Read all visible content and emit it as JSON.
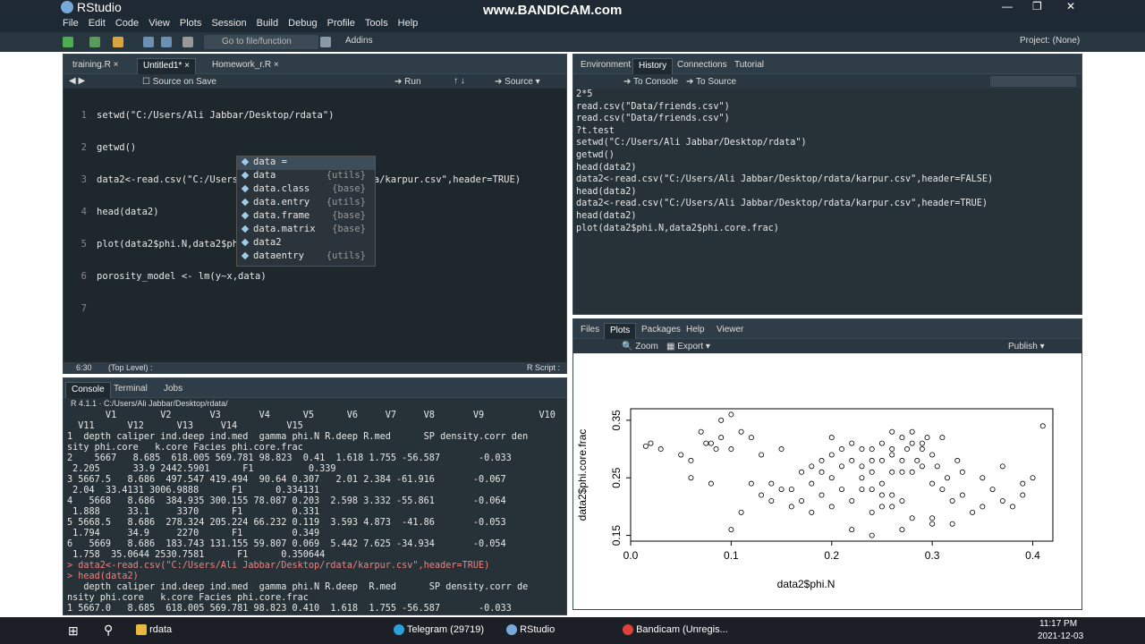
{
  "app": {
    "title": "RStudio",
    "watermark": "www.BANDICAM.com"
  },
  "menu": [
    "File",
    "Edit",
    "Code",
    "View",
    "Plots",
    "Session",
    "Build",
    "Debug",
    "Profile",
    "Tools",
    "Help"
  ],
  "toolbar": {
    "goto": "Go to file/function",
    "addins": "Addins",
    "project": "Project: (None)"
  },
  "editor": {
    "tabs": [
      "training.R",
      "Untitled1*",
      "Homework_r.R"
    ],
    "source_on_save": "Source on Save",
    "run": "Run",
    "source": "Source",
    "line_numbers": [
      "1",
      "2",
      "3",
      "4",
      "5",
      "6",
      "7"
    ],
    "lines": [
      "setwd(\"C:/Users/Ali Jabbar/Desktop/rdata\")",
      "getwd()",
      "data2<-read.csv(\"C:/Users/Ali Jabbar/Desktop/rdata/karpur.csv\",header=TRUE)",
      "head(data2)",
      "plot(data2$phi.N,data2$phi.core.frac)",
      "porosity_model <- lm(y~x,data)",
      ""
    ],
    "status_pos": "6:30",
    "status_scope": "(Top Level) :",
    "status_type": "R Script :"
  },
  "autocomplete": [
    {
      "name": "data =",
      "pkg": ""
    },
    {
      "name": "data",
      "pkg": "{utils}"
    },
    {
      "name": "data.class",
      "pkg": "{base}"
    },
    {
      "name": "data.entry",
      "pkg": "{utils}"
    },
    {
      "name": "data.frame",
      "pkg": "{base}"
    },
    {
      "name": "data.matrix",
      "pkg": "{base}"
    },
    {
      "name": "data2",
      "pkg": ""
    },
    {
      "name": "dataentry",
      "pkg": "{utils}"
    }
  ],
  "console": {
    "tabs": [
      "Console",
      "Terminal",
      "Jobs"
    ],
    "path": "R 4.1.1 · C:/Users/Ali Jabbar/Desktop/rdata/",
    "lines": [
      "       V1        V2       V3       V4      V5      V6     V7     V8       V9          V10",
      "  V11      V12      V13     V14         V15",
      "1  depth caliper ind.deep ind.med  gamma phi.N R.deep R.med      SP density.corr den",
      "sity phi.core   k.core Facies phi.core.frac",
      "2    5667   8.685  618.005 569.781 98.823  0.41  1.618 1.755 -56.587       -0.033",
      " 2.205      33.9 2442.5901      F1          0.339",
      "3 5667.5   8.686  497.547 419.494  90.64 0.307   2.01 2.384 -61.916       -0.067",
      " 2.04  33.4131 3006.9888      F1      0.334131",
      "4   5668   8.686  384.935 300.155 78.087 0.203  2.598 3.332 -55.861       -0.064",
      " 1.888     33.1     3370      F1         0.331",
      "5 5668.5   8.686  278.324 205.224 66.232 0.119  3.593 4.873  -41.86       -0.053",
      " 1.794     34.9     2270      F1         0.349",
      "6   5669   8.686  183.743 131.155 59.807 0.069  5.442 7.625 -34.934       -0.054",
      " 1.758  35.0644 2530.7581      F1      0.350644",
      "> data2<-read.csv(\"C:/Users/Ali Jabbar/Desktop/rdata/karpur.csv\",header=TRUE)",
      "> head(data2)",
      "   depth caliper ind.deep ind.med  gamma phi.N R.deep  R.med      SP density.corr de",
      "nsity phi.core   k.core Facies phi.core.frac",
      "1 5667.0   8.685  618.005 569.781 98.823 0.410  1.618  1.755 -56.587       -0.033"
    ]
  },
  "history": {
    "tabs": [
      "Environment",
      "History",
      "Connections",
      "Tutorial"
    ],
    "to_console": "To Console",
    "to_source": "To Source",
    "lines": [
      "2*5",
      "read.csv(\"Data/friends.csv\")",
      "read.csv(\"Data/friends.csv\")",
      "?t.test",
      "setwd(\"C:/Users/Ali Jabbar/Desktop/rdata\")",
      "getwd()",
      "head(data2)",
      "data2<-read.csv(\"C:/Users/Ali Jabbar/Desktop/rdata/karpur.csv\",header=FALSE)",
      "head(data2)",
      "data2<-read.csv(\"C:/Users/Ali Jabbar/Desktop/rdata/karpur.csv\",header=TRUE)",
      "head(data2)",
      "plot(data2$phi.N,data2$phi.core.frac)"
    ]
  },
  "plots": {
    "tabs": [
      "Files",
      "Plots",
      "Packages",
      "Help",
      "Viewer"
    ],
    "zoom": "Zoom",
    "export": "Export",
    "publish": "Publish"
  },
  "chart_data": {
    "type": "scatter",
    "xlabel": "data2$phi.N",
    "ylabel": "data2$phi.core.frac",
    "xticks": [
      "0.0",
      "0.1",
      "0.2",
      "0.3",
      "0.4"
    ],
    "yticks": [
      "0.15",
      "0.25",
      "0.35"
    ],
    "xlim": [
      0.0,
      0.42
    ],
    "ylim": [
      0.14,
      0.37
    ],
    "points": [
      [
        0.015,
        0.305
      ],
      [
        0.02,
        0.31
      ],
      [
        0.03,
        0.3
      ],
      [
        0.05,
        0.29
      ],
      [
        0.06,
        0.28
      ],
      [
        0.07,
        0.33
      ],
      [
        0.075,
        0.31
      ],
      [
        0.08,
        0.31
      ],
      [
        0.085,
        0.3
      ],
      [
        0.09,
        0.32
      ],
      [
        0.1,
        0.3
      ],
      [
        0.11,
        0.33
      ],
      [
        0.12,
        0.32
      ],
      [
        0.13,
        0.29
      ],
      [
        0.09,
        0.35
      ],
      [
        0.1,
        0.36
      ],
      [
        0.06,
        0.25
      ],
      [
        0.08,
        0.24
      ],
      [
        0.1,
        0.16
      ],
      [
        0.11,
        0.19
      ],
      [
        0.14,
        0.24
      ],
      [
        0.15,
        0.23
      ],
      [
        0.17,
        0.26
      ],
      [
        0.18,
        0.27
      ],
      [
        0.19,
        0.28
      ],
      [
        0.2,
        0.29
      ],
      [
        0.21,
        0.3
      ],
      [
        0.22,
        0.28
      ],
      [
        0.23,
        0.27
      ],
      [
        0.24,
        0.3
      ],
      [
        0.25,
        0.31
      ],
      [
        0.26,
        0.3
      ],
      [
        0.27,
        0.28
      ],
      [
        0.28,
        0.31
      ],
      [
        0.29,
        0.3
      ],
      [
        0.3,
        0.29
      ],
      [
        0.31,
        0.32
      ],
      [
        0.2,
        0.2
      ],
      [
        0.22,
        0.21
      ],
      [
        0.24,
        0.19
      ],
      [
        0.25,
        0.2
      ],
      [
        0.26,
        0.2
      ],
      [
        0.27,
        0.21
      ],
      [
        0.28,
        0.18
      ],
      [
        0.3,
        0.18
      ],
      [
        0.32,
        0.17
      ],
      [
        0.34,
        0.19
      ],
      [
        0.35,
        0.2
      ],
      [
        0.37,
        0.21
      ],
      [
        0.39,
        0.24
      ],
      [
        0.4,
        0.25
      ],
      [
        0.41,
        0.34
      ],
      [
        0.23,
        0.25
      ],
      [
        0.24,
        0.26
      ],
      [
        0.25,
        0.24
      ],
      [
        0.26,
        0.26
      ],
      [
        0.21,
        0.23
      ],
      [
        0.19,
        0.22
      ],
      [
        0.18,
        0.19
      ],
      [
        0.16,
        0.2
      ],
      [
        0.22,
        0.16
      ],
      [
        0.24,
        0.15
      ],
      [
        0.27,
        0.16
      ],
      [
        0.3,
        0.17
      ],
      [
        0.33,
        0.26
      ],
      [
        0.35,
        0.25
      ],
      [
        0.37,
        0.27
      ],
      [
        0.15,
        0.3
      ],
      [
        0.13,
        0.22
      ],
      [
        0.12,
        0.24
      ],
      [
        0.26,
        0.33
      ],
      [
        0.27,
        0.32
      ],
      [
        0.28,
        0.33
      ],
      [
        0.29,
        0.31
      ],
      [
        0.23,
        0.23
      ],
      [
        0.25,
        0.22
      ],
      [
        0.26,
        0.22
      ],
      [
        0.24,
        0.23
      ],
      [
        0.2,
        0.25
      ],
      [
        0.18,
        0.24
      ],
      [
        0.16,
        0.23
      ],
      [
        0.17,
        0.21
      ],
      [
        0.14,
        0.21
      ],
      [
        0.3,
        0.24
      ],
      [
        0.31,
        0.23
      ],
      [
        0.32,
        0.21
      ],
      [
        0.33,
        0.22
      ],
      [
        0.36,
        0.23
      ],
      [
        0.38,
        0.2
      ],
      [
        0.39,
        0.22
      ],
      [
        0.29,
        0.27
      ],
      [
        0.28,
        0.26
      ],
      [
        0.27,
        0.26
      ],
      [
        0.21,
        0.27
      ],
      [
        0.22,
        0.31
      ],
      [
        0.2,
        0.32
      ],
      [
        0.19,
        0.26
      ],
      [
        0.26,
        0.29
      ],
      [
        0.25,
        0.28
      ],
      [
        0.24,
        0.28
      ],
      [
        0.23,
        0.3
      ],
      [
        0.275,
        0.3
      ],
      [
        0.285,
        0.28
      ],
      [
        0.295,
        0.32
      ],
      [
        0.305,
        0.27
      ],
      [
        0.315,
        0.25
      ],
      [
        0.325,
        0.28
      ]
    ]
  },
  "taskbar": {
    "items": [
      "rdata",
      "Telegram (29719)",
      "RStudio",
      "Bandicam (Unregis..."
    ],
    "time": "11:17 PM",
    "date": "2021-12-03"
  }
}
